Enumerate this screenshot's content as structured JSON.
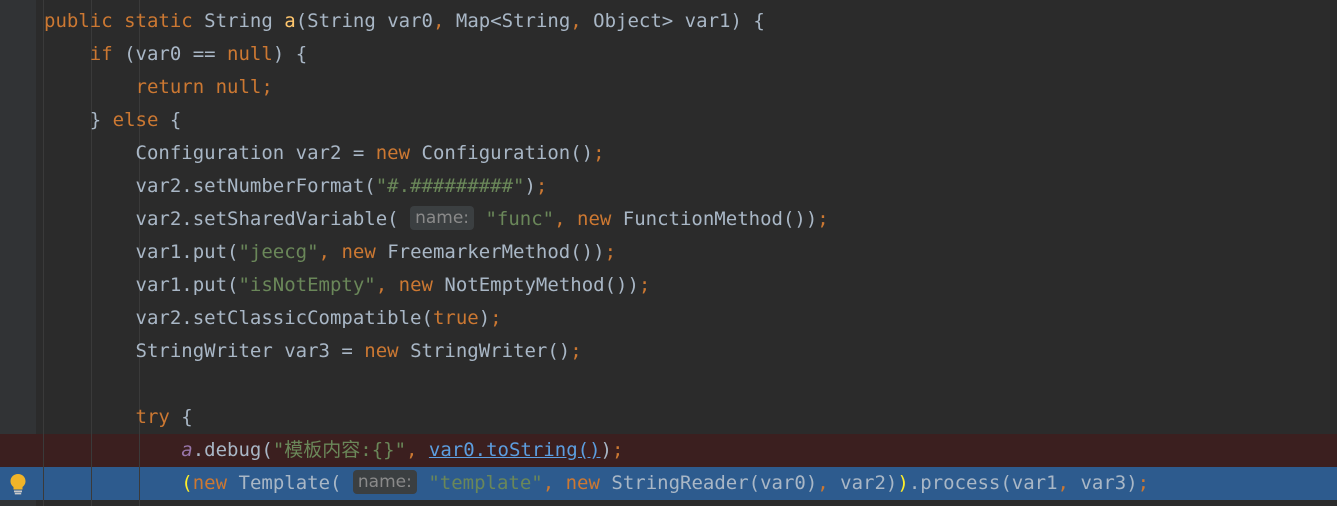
{
  "code": {
    "l1": {
      "kw1": "public",
      "kw2": "static",
      "text1": " String ",
      "fn": "a",
      "text2": "(String var0",
      "comma": ",",
      "text3": " Map<String",
      "comma2": ",",
      "text4": " Object> var1) {"
    },
    "l2": {
      "kw": "if",
      "text1": " (var0 == ",
      "null": "null",
      "text2": ") {"
    },
    "l3": {
      "kw": "return",
      "null": "null",
      "semi": ";"
    },
    "l4": {
      "text1": "} ",
      "kw": "else",
      "text2": " {"
    },
    "l5": {
      "text1": "Configuration var2 = ",
      "kw": "new",
      "text2": " Configuration()",
      "semi": ";"
    },
    "l6": {
      "text1": "var2.setNumberFormat(",
      "str": "\"#.#########\"",
      "text2": ")",
      "semi": ";"
    },
    "l7": {
      "text1": "var2.setSharedVariable(",
      "hint": "name:",
      "str": "\"func\"",
      "comma": ",",
      "kw": "new",
      "text2": " FunctionMethod())",
      "semi": ";"
    },
    "l8": {
      "text1": "var1.put(",
      "str": "\"jeecg\"",
      "comma": ",",
      "kw": "new",
      "text2": " FreemarkerMethod())",
      "semi": ";"
    },
    "l9": {
      "text1": "var1.put(",
      "str": "\"isNotEmpty\"",
      "comma": ",",
      "kw": "new",
      "text2": " NotEmptyMethod())",
      "semi": ";"
    },
    "l10": {
      "text1": "var2.setClassicCompatible(",
      "kw": "true",
      "text2": ")",
      "semi": ";"
    },
    "l11": {
      "text1": "StringWriter var3 = ",
      "kw": "new",
      "text2": " StringWriter()",
      "semi": ";"
    },
    "l12": {
      "kw": "try",
      "text1": " {"
    },
    "l13": {
      "ital": "a",
      "text1": ".debug(",
      "str": "\"模板内容:{}\"",
      "comma": ",",
      "lnk": "var0.toString()",
      "text2": ")",
      "semi": ";"
    },
    "l14": {
      "brace1": "(",
      "kw": "new",
      "text1": " Template(",
      "hint": "name:",
      "str": "\"template\"",
      "comma": ",",
      "kw2": "new",
      "text2": " StringReader(var0)",
      "comma2": ",",
      "text3": " var2)",
      "brace2": ")",
      "text4": ".process(var1",
      "comma3": ",",
      "text5": " var3)",
      "semi": ";"
    }
  },
  "icons": {
    "intention": "lightbulb-icon"
  },
  "colors": {
    "background": "#2b2b2b",
    "keyword": "#cc7832",
    "string": "#6a8759",
    "method": "#ffc66d",
    "current_line": "#2d5b8e",
    "error_line": "#3b1f1f"
  }
}
